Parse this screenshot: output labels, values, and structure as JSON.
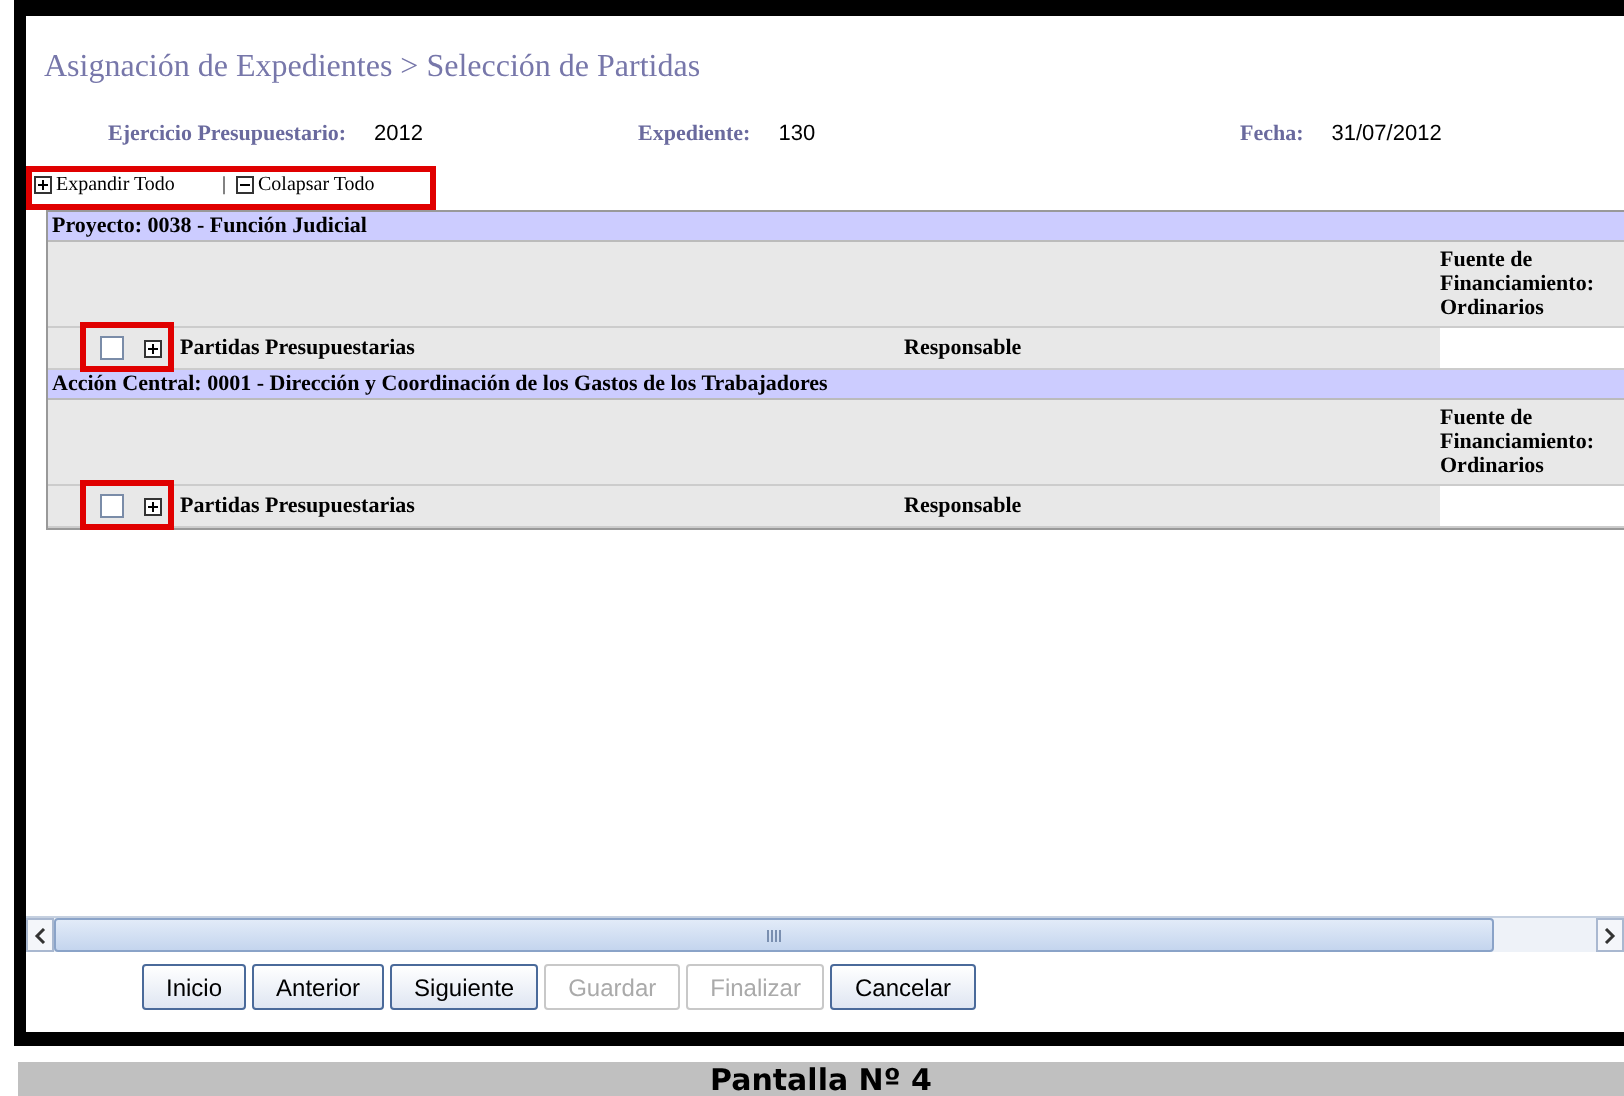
{
  "page": {
    "title": "Asignación de Expedientes > Selección de Partidas"
  },
  "fields": [
    {
      "label": "Ejercicio Presupuestario:",
      "value": "2012"
    },
    {
      "label": "Expediente:",
      "value": "130"
    },
    {
      "label": "Fecha:",
      "value": "31/07/2012"
    }
  ],
  "tree_controls": [
    {
      "kind": "expand",
      "label": "Expandir Todo"
    },
    {
      "kind": "collapse",
      "separator": "|",
      "label": "Colapsar Todo"
    }
  ],
  "groups": [
    {
      "title": "Proyecto: 0038 - Función Judicial",
      "funding": "Fuente de Financiamiento: Ordinarios",
      "checked": false,
      "expanded": false,
      "column_1": "Partidas Presupuestarias",
      "column_2": "Responsable"
    },
    {
      "title": "Acción Central: 0001 - Dirección y Coordinación de los Gastos de los Trabajadores",
      "funding": "Fuente de Financiamiento: Ordinarios",
      "checked": false,
      "expanded": false,
      "column_1": "Partidas Presupuestarias",
      "column_2": "Responsable"
    }
  ],
  "buttons": [
    {
      "label": "Inicio",
      "disabled": false
    },
    {
      "label": "Anterior",
      "disabled": false
    },
    {
      "label": "Siguiente",
      "disabled": false
    },
    {
      "label": "Guardar",
      "disabled": true
    },
    {
      "label": "Finalizar",
      "disabled": true
    },
    {
      "label": "Cancelar",
      "disabled": false
    }
  ],
  "caption": "Pantalla Nº 4"
}
